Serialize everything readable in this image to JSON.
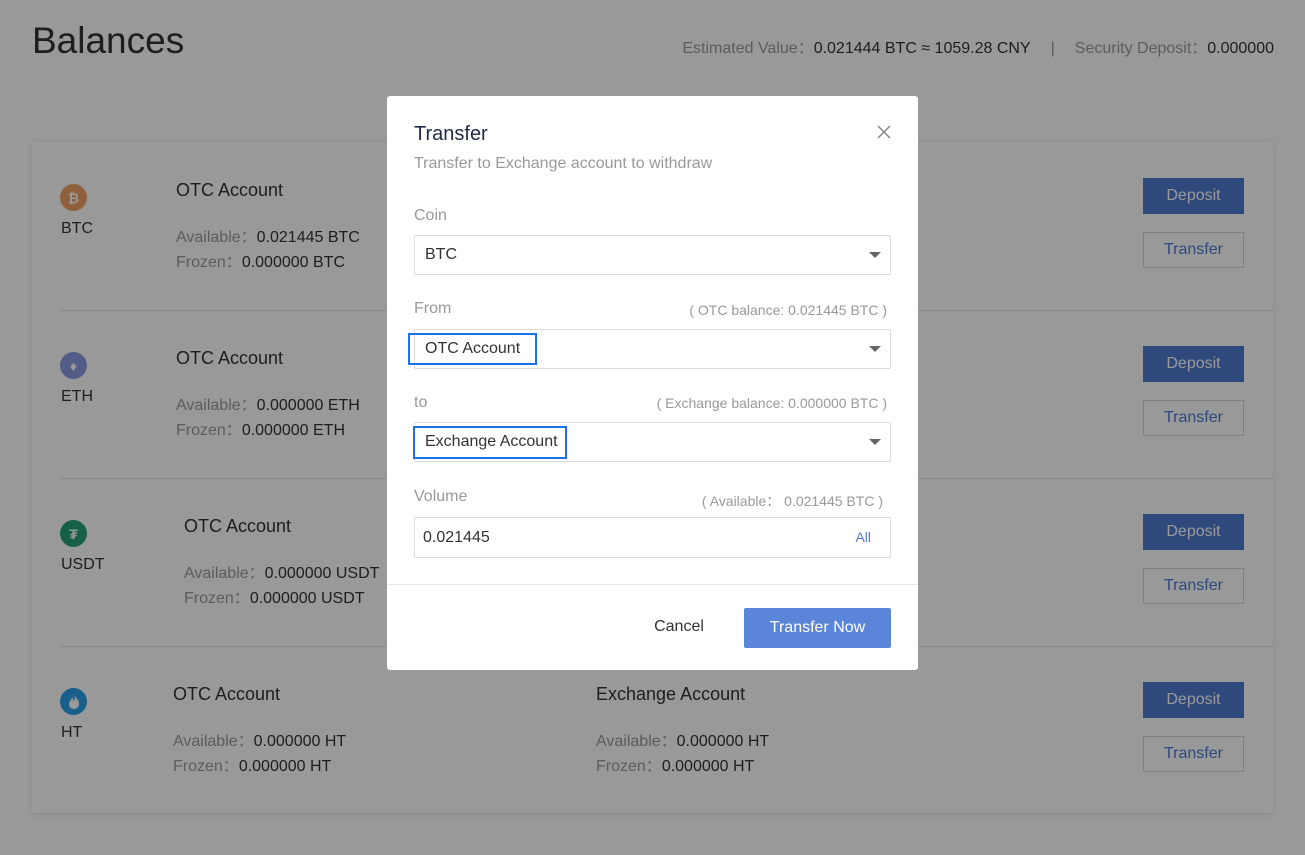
{
  "page": {
    "title": "Balances",
    "estimated_label": "Estimated Value：",
    "estimated_value": "0.021444 BTC ≈ 1059.28 CNY",
    "separator": "|",
    "deposit_label": "Security Deposit：",
    "deposit_value": "0.000000"
  },
  "balances": [
    {
      "coin": "BTC",
      "icon": "bitcoin-icon",
      "icon_color": "#f7931a",
      "icon_glyph": "₿",
      "otc": {
        "title": "OTC Account",
        "available_label": "Available：",
        "available": "0.021445 BTC",
        "frozen_label": "Frozen：",
        "frozen": "0.000000 BTC"
      },
      "deposit": "Deposit",
      "transfer": "Transfer"
    },
    {
      "coin": "ETH",
      "icon": "ethereum-icon",
      "icon_color": "#627eea",
      "icon_glyph": "♦",
      "otc": {
        "title": "OTC Account",
        "available_label": "Available：",
        "available": "0.000000 ETH",
        "frozen_label": "Frozen：",
        "frozen": "0.000000 ETH"
      },
      "deposit": "Deposit",
      "transfer": "Transfer"
    },
    {
      "coin": "USDT",
      "icon": "tether-icon",
      "icon_color": "#26a17b",
      "icon_glyph": "₮",
      "otc": {
        "title": "OTC Account",
        "available_label": "Available：",
        "available": "0.000000 USDT",
        "frozen_label": "Frozen：",
        "frozen": "0.000000 USDT"
      },
      "deposit": "Deposit",
      "transfer": "Transfer"
    },
    {
      "coin": "HT",
      "icon": "huobi-token-icon",
      "icon_color": "#2a9fe8",
      "icon_glyph": "♥",
      "otc": {
        "title": "OTC Account",
        "available_label": "Available：",
        "available": "0.000000 HT",
        "frozen_label": "Frozen：",
        "frozen": "0.000000 HT"
      },
      "exchange": {
        "title": "Exchange Account",
        "available_label": "Available：",
        "available": "0.000000 HT",
        "frozen_label": "Frozen：",
        "frozen": "0.000000 HT"
      },
      "deposit": "Deposit",
      "transfer": "Transfer"
    }
  ],
  "modal": {
    "title": "Transfer",
    "subtitle": "Transfer to Exchange account to withdraw",
    "close_icon": "close-icon",
    "coin_label": "Coin",
    "coin_value": "BTC",
    "from_label": "From",
    "from_hint": "( OTC balance: 0.021445 BTC )",
    "from_value": "OTC Account",
    "to_label": "to",
    "to_hint": "( Exchange balance: 0.000000 BTC )",
    "to_value": "Exchange Account",
    "volume_label": "Volume",
    "volume_hint": "( Available： 0.021445 BTC )",
    "volume_value": "0.021445",
    "all_label": "All",
    "cancel_label": "Cancel",
    "submit_label": "Transfer Now",
    "highlight_color": "#1a73e8",
    "primary_color": "#5b85d8"
  }
}
